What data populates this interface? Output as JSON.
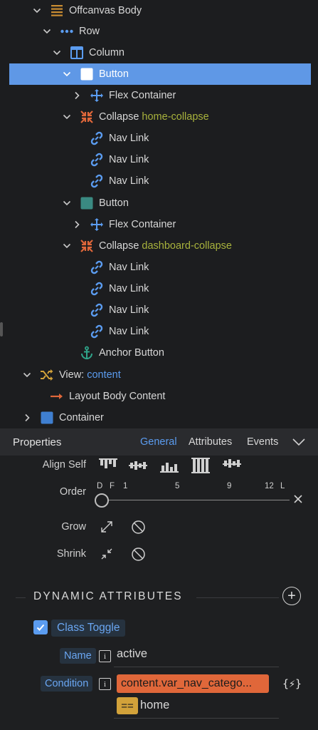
{
  "tree": {
    "nodes": [
      {
        "label": "Offcanvas Body",
        "expanded": true,
        "icon": "offcanvas-body-icon"
      },
      {
        "label": "Row",
        "expanded": true,
        "icon": "row-icon"
      },
      {
        "label": "Column",
        "expanded": true,
        "icon": "column-icon"
      },
      {
        "label": "Button",
        "expanded": true,
        "icon": "button-icon",
        "selected": true
      },
      {
        "label": "Flex Container",
        "expanded": false,
        "icon": "flex-container-icon"
      },
      {
        "label": "Collapse",
        "suffix": "home-collapse",
        "expanded": true,
        "icon": "collapse-icon"
      },
      {
        "label": "Nav Link",
        "icon": "link-icon"
      },
      {
        "label": "Nav Link",
        "icon": "link-icon"
      },
      {
        "label": "Nav Link",
        "icon": "link-icon"
      },
      {
        "label": "Button",
        "expanded": true,
        "icon": "button-icon"
      },
      {
        "label": "Flex Container",
        "expanded": false,
        "icon": "flex-container-icon"
      },
      {
        "label": "Collapse",
        "suffix": "dashboard-collapse",
        "expanded": true,
        "icon": "collapse-icon"
      },
      {
        "label": "Nav Link",
        "icon": "link-icon"
      },
      {
        "label": "Nav Link",
        "icon": "link-icon"
      },
      {
        "label": "Nav Link",
        "icon": "link-icon"
      },
      {
        "label": "Nav Link",
        "icon": "link-icon"
      },
      {
        "label": "Anchor Button",
        "icon": "anchor-icon"
      },
      {
        "label": "View:",
        "suffix": "content",
        "expanded": true,
        "icon": "view-icon"
      },
      {
        "label": "Layout Body Content",
        "icon": "arrow-right-icon"
      },
      {
        "label": "Container",
        "expanded": false,
        "icon": "container-icon"
      }
    ]
  },
  "properties": {
    "title": "Properties",
    "tabs": [
      "General",
      "Attributes",
      "Events"
    ],
    "active_tab": "General"
  },
  "layout": {
    "align_self_label": "Align Self",
    "order_label": "Order",
    "order_ticks": [
      "D",
      "F",
      "1",
      "5",
      "9",
      "12",
      "L"
    ],
    "grow_label": "Grow",
    "shrink_label": "Shrink"
  },
  "dynamic": {
    "section_title": "DYNAMIC ATTRIBUTES",
    "class_toggle_label": "Class Toggle",
    "class_toggle_checked": true,
    "name_label": "Name",
    "name_value": "active",
    "condition_label": "Condition",
    "condition_expr": "content.var_nav_catego...",
    "operator": "==",
    "compare_value": "home",
    "dynamic_button": "{⚡}"
  },
  "colors": {
    "selection": "#5f98e6",
    "accent_blue": "#5b9cf0",
    "collapse_orange": "#e0673a",
    "suffix_green": "#a8b23c",
    "operator_yellow": "#d2a23a"
  }
}
